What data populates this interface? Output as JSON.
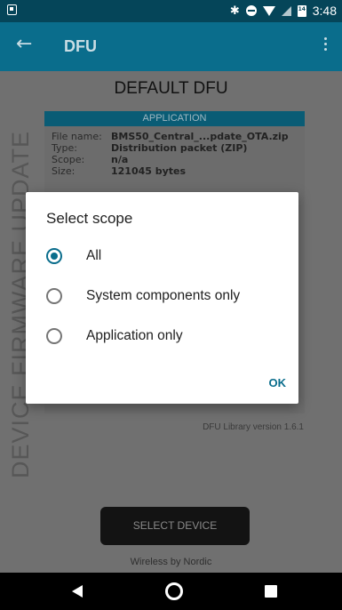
{
  "status_bar": {
    "time": "3:48"
  },
  "app_bar": {
    "title": "DFU"
  },
  "main": {
    "vertical_text": "DEVICE FIRMWARE UPDATE",
    "section_title": "DEFAULT DFU",
    "card": {
      "header": "APPLICATION",
      "rows": [
        {
          "key": "File name:",
          "value": "BMS50_Central_...pdate_OTA.zip"
        },
        {
          "key": "Type:",
          "value": "Distribution packet (ZIP)"
        },
        {
          "key": "Scope:",
          "value": "n/a"
        },
        {
          "key": "Size:",
          "value": "121045 bytes"
        }
      ]
    },
    "library_version": "DFU Library version 1.6.1",
    "select_device_label": "SELECT DEVICE",
    "footer": "Wireless by Nordic"
  },
  "dialog": {
    "title": "Select scope",
    "options": [
      {
        "label": "All",
        "selected": true
      },
      {
        "label": "System components only",
        "selected": false
      },
      {
        "label": "Application only",
        "selected": false
      }
    ],
    "ok_label": "OK"
  },
  "colors": {
    "accent": "#0a6d8c",
    "statusbar": "#054559"
  }
}
